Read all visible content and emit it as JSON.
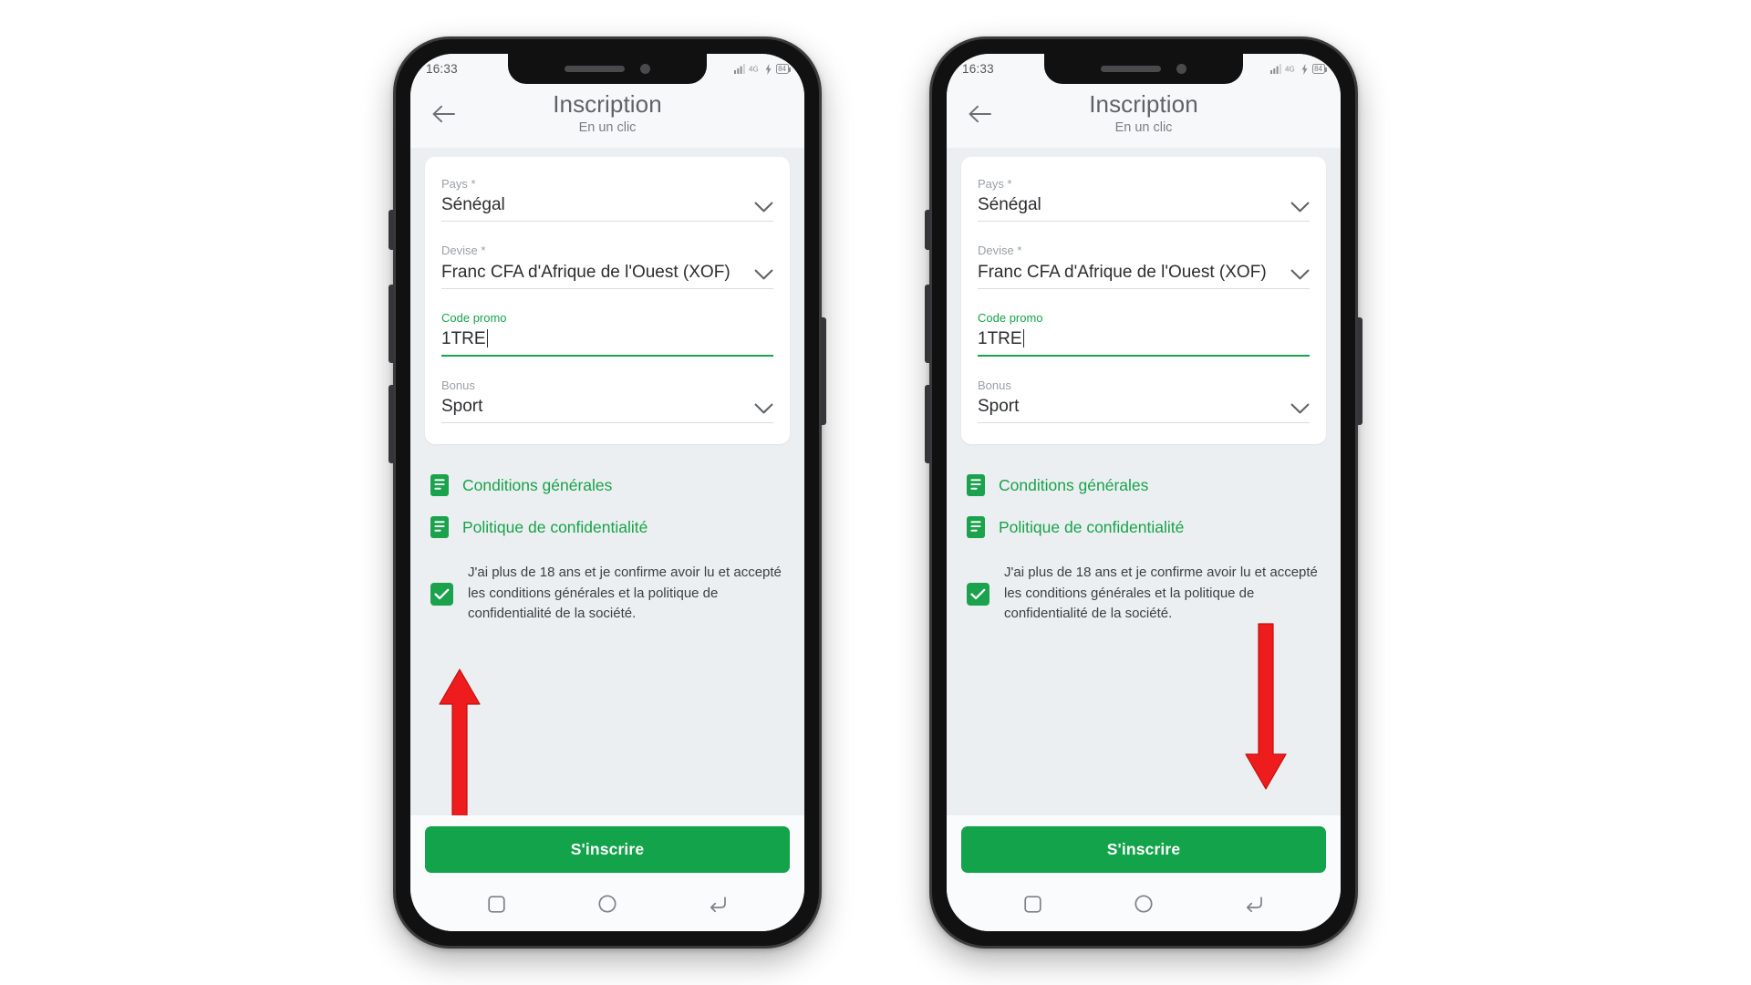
{
  "device": {
    "status_bar": {
      "time": "16:33",
      "icons": [
        "signal-icon",
        "network-4g-icon",
        "charging-bolt-icon",
        "battery-icon"
      ],
      "battery_level": "84"
    },
    "nav_bar": {
      "buttons": [
        {
          "name": "recents-button",
          "icon": "square-icon"
        },
        {
          "name": "home-button",
          "icon": "circle-icon"
        },
        {
          "name": "back-button",
          "icon": "back-arrow-icon"
        }
      ]
    },
    "hardware_buttons": [
      "silent-switch",
      "volume-up-button",
      "volume-down-button",
      "power-button"
    ]
  },
  "header": {
    "back_icon": "arrow-left-icon",
    "title": "Inscription",
    "subtitle": "En un clic"
  },
  "form": {
    "fields": [
      {
        "id": "pays",
        "label": "Pays *",
        "value": "Sénégal",
        "type": "select",
        "icon": "chevron-down-icon",
        "focused": false
      },
      {
        "id": "devise",
        "label": "Devise *",
        "value": "Franc CFA d'Afrique de l'Ouest (XOF)",
        "type": "select",
        "icon": "chevron-down-icon",
        "focused": false
      },
      {
        "id": "code-promo",
        "label": "Code promo",
        "value": "1TRE",
        "type": "text",
        "placeholder": "Code promo",
        "focused": true
      },
      {
        "id": "bonus",
        "label": "Bonus",
        "value": "Sport",
        "type": "select",
        "icon": "chevron-down-icon",
        "focused": false
      }
    ]
  },
  "legal": {
    "links": [
      {
        "id": "conditions-generales",
        "label": "Conditions générales",
        "icon": "document-icon"
      },
      {
        "id": "politique-confidentialite",
        "label": "Politique de confidentialité",
        "icon": "document-icon"
      }
    ],
    "consent": {
      "checked": true,
      "check_icon": "checkmark-icon",
      "text": "J'ai plus de 18 ans et je confirme avoir lu et accepté les conditions générales et la politique de confidentialité de la société."
    }
  },
  "footer": {
    "submit_label": "S'inscrire"
  },
  "annotations": {
    "left_phone": {
      "arrow": "arrow-up-icon",
      "target": "consent-checkbox",
      "color": "#ee1c1c"
    },
    "right_phone": {
      "arrow": "arrow-down-icon",
      "target": "submit-button",
      "color": "#ee1c1c"
    }
  },
  "colors": {
    "brand_green": "#13a34a",
    "link_green": "#17a34a",
    "annotation_red": "#ee1c1c",
    "screen_bg": "#eceff1",
    "card_bg": "#ffffff",
    "title_gray": "#5f6368"
  }
}
